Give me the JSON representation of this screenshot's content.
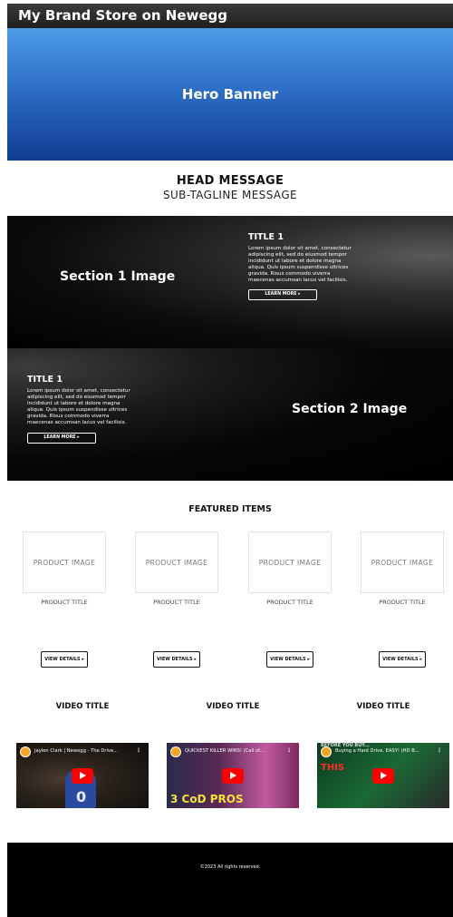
{
  "store_title": "My Brand Store on Newegg",
  "hero": {
    "label": "Hero Banner"
  },
  "head_message": "HEAD MESSAGE",
  "sub_tagline": "SUB-TAGLINE MESSAGE",
  "section1": {
    "image_label": "Section 1 Image",
    "title": "TITLE 1",
    "body": "Lorem ipsum dolor sit amet, consectetur adipiscing elit, sed do eiusmod tempor incididunt ut labore et dolore magna aliqua. Quis ipsum suspendisse ultrices gravida. Risus commodo viverra maecenas accumsan lacus vel facilisis.",
    "button": "LEARN MORE ▸"
  },
  "section2": {
    "image_label": "Section 2 Image",
    "title": "TITLE 1",
    "body": "Lorem ipsum dolor sit amet, consectetur adipiscing elit, sed do eiusmod tempor incididunt ut labore et dolore magna aliqua. Quis ipsum suspendisse ultrices gravida. Risus commodo viverra maecenas accumsan lacus vel facilisis.",
    "button": "LEARN MORE ▸"
  },
  "featured": {
    "title": "FEATURED ITEMS",
    "products": [
      {
        "image_label": "PRODUCT IMAGE",
        "title": "PRODUCT TITLE",
        "button": "VIEW DETAILS ▸"
      },
      {
        "image_label": "PRODUCT IMAGE",
        "title": "PRODUCT TITLE",
        "button": "VIEW DETAILS ▸"
      },
      {
        "image_label": "PRODUCT IMAGE",
        "title": "PRODUCT TITLE",
        "button": "VIEW DETAILS ▸"
      },
      {
        "image_label": "PRODUCT IMAGE",
        "title": "PRODUCT TITLE",
        "button": "VIEW DETAILS ▸"
      }
    ]
  },
  "videos": [
    {
      "title": "VIDEO TITLE",
      "caption": "Jaylen Clark | Newegg - The Drive...",
      "overlay_num": "0"
    },
    {
      "title": "VIDEO TITLE",
      "caption": "QUICKEST KILLER WINS! (Call of...",
      "overlay_text": "3 CoD PROS"
    },
    {
      "title": "VIDEO TITLE",
      "caption": "Buying a Hard Drive, EASY! (HD B...",
      "overlay_top": "BEFORE YOU BUY...",
      "overlay_text": "THIS"
    }
  ],
  "footer": {
    "copyright": "©2023 All rights reserved."
  },
  "colors": {
    "hero_top": "#4c9be6",
    "hero_bottom": "#103c92",
    "play_red": "#ff0000",
    "footer_bg": "#000000"
  }
}
